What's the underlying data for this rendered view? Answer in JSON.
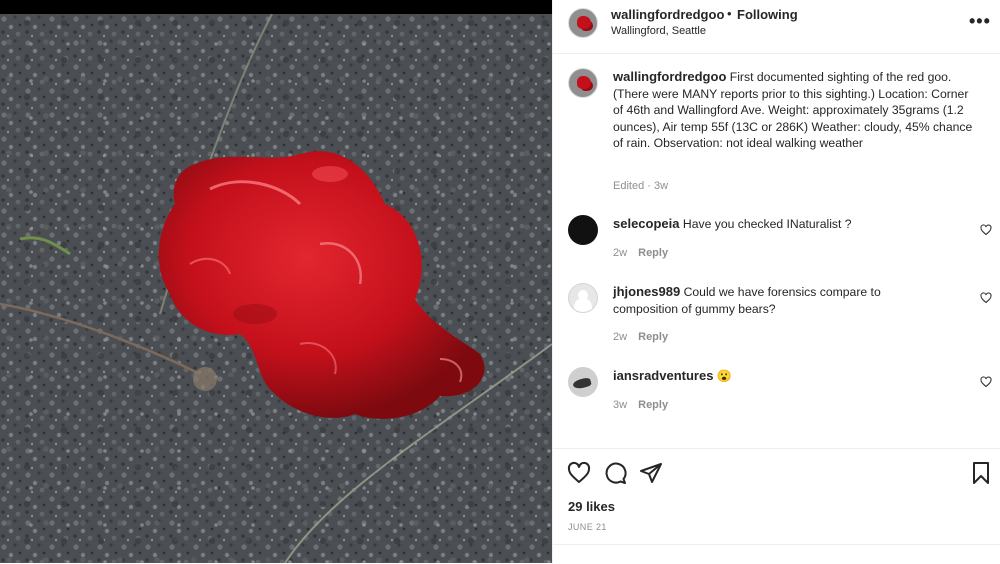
{
  "post": {
    "username": "wallingfordredgoo",
    "separator": "•",
    "following_label": "Following",
    "location": "Wallingford, Seattle",
    "more_icon": "more-horizontal-icon",
    "caption_text": "First documented sighting of the red goo. (There were MANY reports prior to this sighting.) Location: Corner of 46th and Wallingford Ave. Weight: approximately 35grams (1.2 ounces), Air temp 55f (13C or 286K) Weather: cloudy, 45% chance of rain. Observation: not ideal walking weather",
    "caption_meta": "Edited · 3w",
    "likes": "29 likes",
    "date": "JUNE 21"
  },
  "comments": [
    {
      "username": "selecopeia",
      "text": "Have you checked INaturalist ?",
      "age": "2w",
      "reply_label": "Reply"
    },
    {
      "username": "jhjones989",
      "text": "Could we have forensics compare to composition of gummy bears?",
      "age": "2w",
      "reply_label": "Reply"
    },
    {
      "username": "iansradventures",
      "text": "😮",
      "age": "3w",
      "reply_label": "Reply"
    }
  ],
  "colors": {
    "goo": "#c4101b",
    "asphalt": "#4a4d52",
    "text": "#262626",
    "muted": "#8e8e8e"
  }
}
